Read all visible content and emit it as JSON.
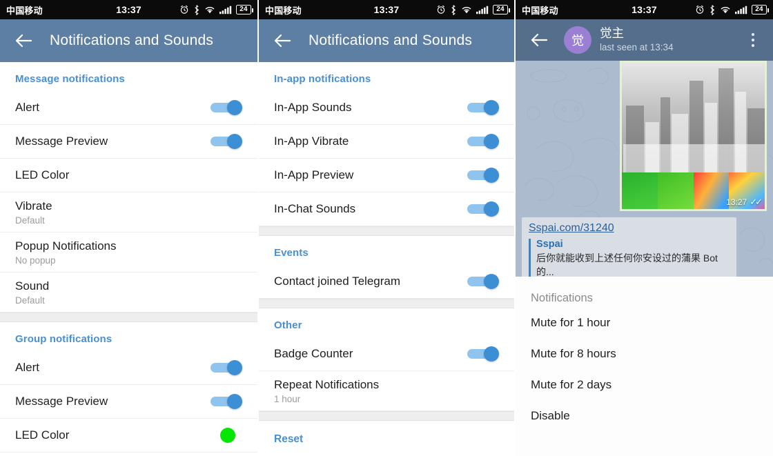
{
  "statusbar": {
    "carrier": "中国移动",
    "time": "13:37",
    "battery": "24",
    "icons": [
      "alarm-icon",
      "bluetooth-icon",
      "wifi-icon",
      "signal-icon",
      "battery-icon"
    ]
  },
  "panel1": {
    "appbar": {
      "title": "Notifications and Sounds",
      "back": "back-arrow-icon"
    },
    "sections": [
      {
        "heading": "Message notifications",
        "rows": [
          {
            "title": "Alert",
            "sub": "",
            "control": "toggle",
            "on": true
          },
          {
            "title": "Message Preview",
            "sub": "",
            "control": "toggle",
            "on": true
          },
          {
            "title": "LED Color",
            "sub": "",
            "control": "none"
          },
          {
            "title": "Vibrate",
            "sub": "Default",
            "control": "none"
          },
          {
            "title": "Popup Notifications",
            "sub": "No popup",
            "control": "none"
          },
          {
            "title": "Sound",
            "sub": "Default",
            "control": "none"
          }
        ]
      },
      {
        "heading": "Group notifications",
        "rows": [
          {
            "title": "Alert",
            "sub": "",
            "control": "toggle",
            "on": true
          },
          {
            "title": "Message Preview",
            "sub": "",
            "control": "toggle",
            "on": true
          },
          {
            "title": "LED Color",
            "sub": "",
            "control": "led",
            "color": "#05e605"
          }
        ]
      }
    ]
  },
  "panel2": {
    "appbar": {
      "title": "Notifications and Sounds",
      "back": "back-arrow-icon"
    },
    "sections": [
      {
        "heading": "In-app notifications",
        "rows": [
          {
            "title": "In-App Sounds",
            "sub": "",
            "control": "toggle",
            "on": true
          },
          {
            "title": "In-App Vibrate",
            "sub": "",
            "control": "toggle",
            "on": true
          },
          {
            "title": "In-App Preview",
            "sub": "",
            "control": "toggle",
            "on": true
          },
          {
            "title": "In-Chat Sounds",
            "sub": "",
            "control": "toggle",
            "on": true
          }
        ]
      },
      {
        "heading": "Events",
        "rows": [
          {
            "title": "Contact joined Telegram",
            "sub": "",
            "control": "toggle",
            "on": true
          }
        ]
      },
      {
        "heading": "Other",
        "rows": [
          {
            "title": "Badge Counter",
            "sub": "",
            "control": "toggle",
            "on": true
          },
          {
            "title": "Repeat Notifications",
            "sub": "1 hour",
            "control": "none"
          }
        ]
      }
    ],
    "reset_label": "Reset"
  },
  "panel3": {
    "appbar": {
      "back": "back-arrow-icon",
      "avatar_initial": "觉",
      "name": "觉主",
      "status": "last seen at 13:34",
      "menu": "overflow-menu-icon"
    },
    "message": {
      "image_time": "13:27",
      "read_ticks": "✓✓",
      "link_url": "Sspai.com/31240",
      "link_site": "Sspai",
      "link_desc": "后你就能收到上述任何你安设过的蒲果 Bot 的..."
    },
    "sheet": {
      "title": "Notifications",
      "options": [
        "Mute for 1 hour",
        "Mute for 8 hours",
        "Mute for 2 days",
        "Disable"
      ]
    }
  },
  "colors": {
    "appbar": "#5d7fa3",
    "chat_appbar": "#546e8c",
    "accent": "#4a8fd1",
    "toggle_track": "#8fc4ef",
    "toggle_thumb": "#3d8fd5",
    "led_green": "#05e605",
    "avatar": "#9b7fd4"
  }
}
